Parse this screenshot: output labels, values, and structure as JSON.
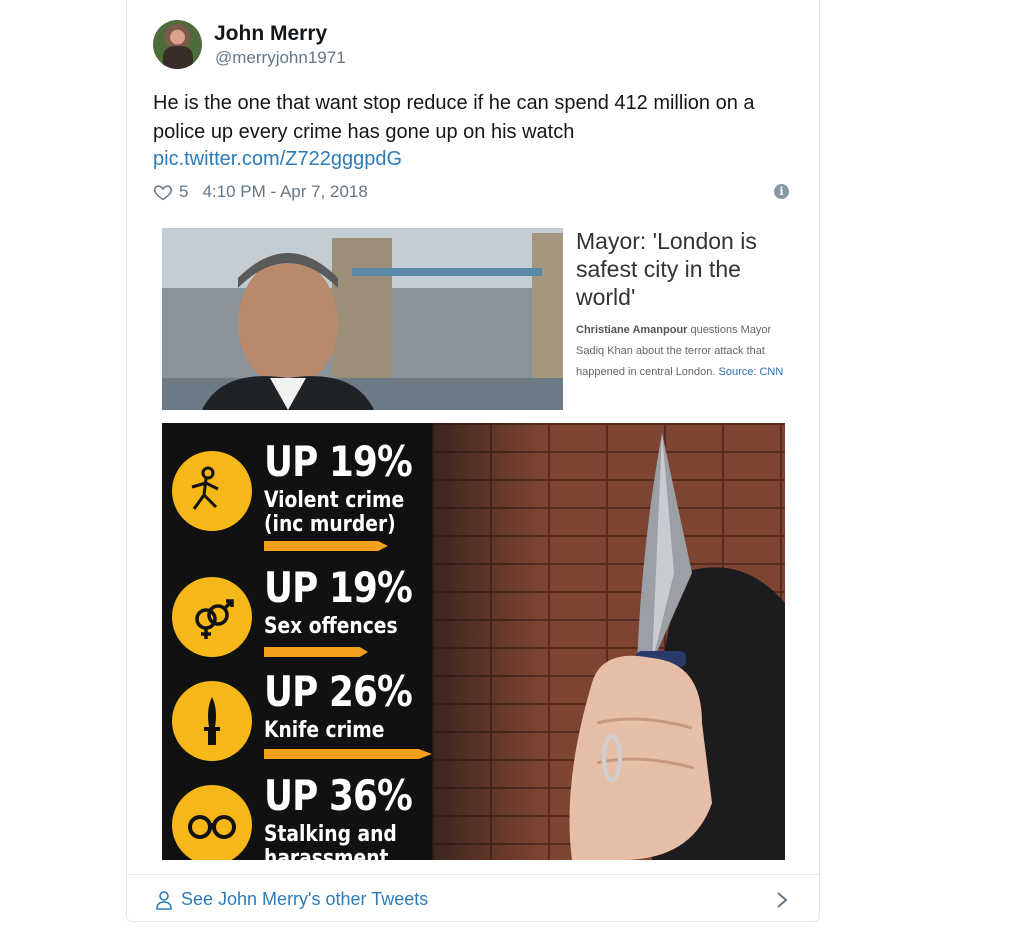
{
  "tweet": {
    "author_name": "John Merry",
    "author_handle": "@merryjohn1971",
    "text": "He is the one that want stop reduce if he can spend 412 million on a police up every crime has gone up on his watch",
    "link": "pic.twitter.com/Z722gggpdG",
    "likes": "5",
    "timestamp": "4:10 PM - Apr 7, 2018",
    "info_symbol": "i"
  },
  "media": {
    "headline": "Mayor: 'London is safest city in the world'",
    "caption_name": "Christiane Amanpour",
    "caption_text": " questions Mayor Sadiq Khan about the terror attack that happened in central London.",
    "caption_source": "Source: CNN",
    "stats": [
      {
        "value": "UP 19%",
        "label_line1": "Violent crime",
        "label_line2": "(inc murder)",
        "icon": "body-outline-icon"
      },
      {
        "value": "UP 19%",
        "label_line1": "Sex offences",
        "label_line2": "",
        "icon": "gender-symbols-icon"
      },
      {
        "value": "UP 26%",
        "label_line1": "Knife crime",
        "label_line2": "",
        "icon": "knife-icon"
      },
      {
        "value": "UP 36%",
        "label_line1": "Stalking and",
        "label_line2": "harassment",
        "icon": "binoculars-icon"
      }
    ]
  },
  "footer": {
    "link_text": "See John Merry's other Tweets"
  },
  "colors": {
    "link": "#2b7bb9",
    "infographic_accent": "#f5b818",
    "text_muted": "#657786"
  }
}
